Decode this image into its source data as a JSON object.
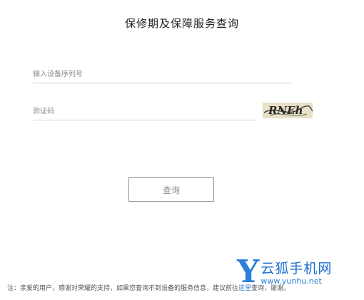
{
  "page": {
    "title": "保修期及保障服务查询"
  },
  "form": {
    "serial_placeholder": "输入设备序列号",
    "captcha_placeholder": "验证码",
    "captcha_text": "RNEh",
    "submit_label": "查询"
  },
  "footer": {
    "note_prefix": "注：亲爱的用户，感谢对荣耀的支持，如果您查询不到设备的服务信息，建议前往",
    "note_link": "这里",
    "note_suffix": "查询，谢谢。"
  },
  "watermark": {
    "letter": "Y",
    "name": "云狐手机网",
    "url": "www.yunhu.net"
  },
  "colors": {
    "watermark_blue": "#2b7fd8",
    "captcha_bg": "#e8e1c8"
  }
}
